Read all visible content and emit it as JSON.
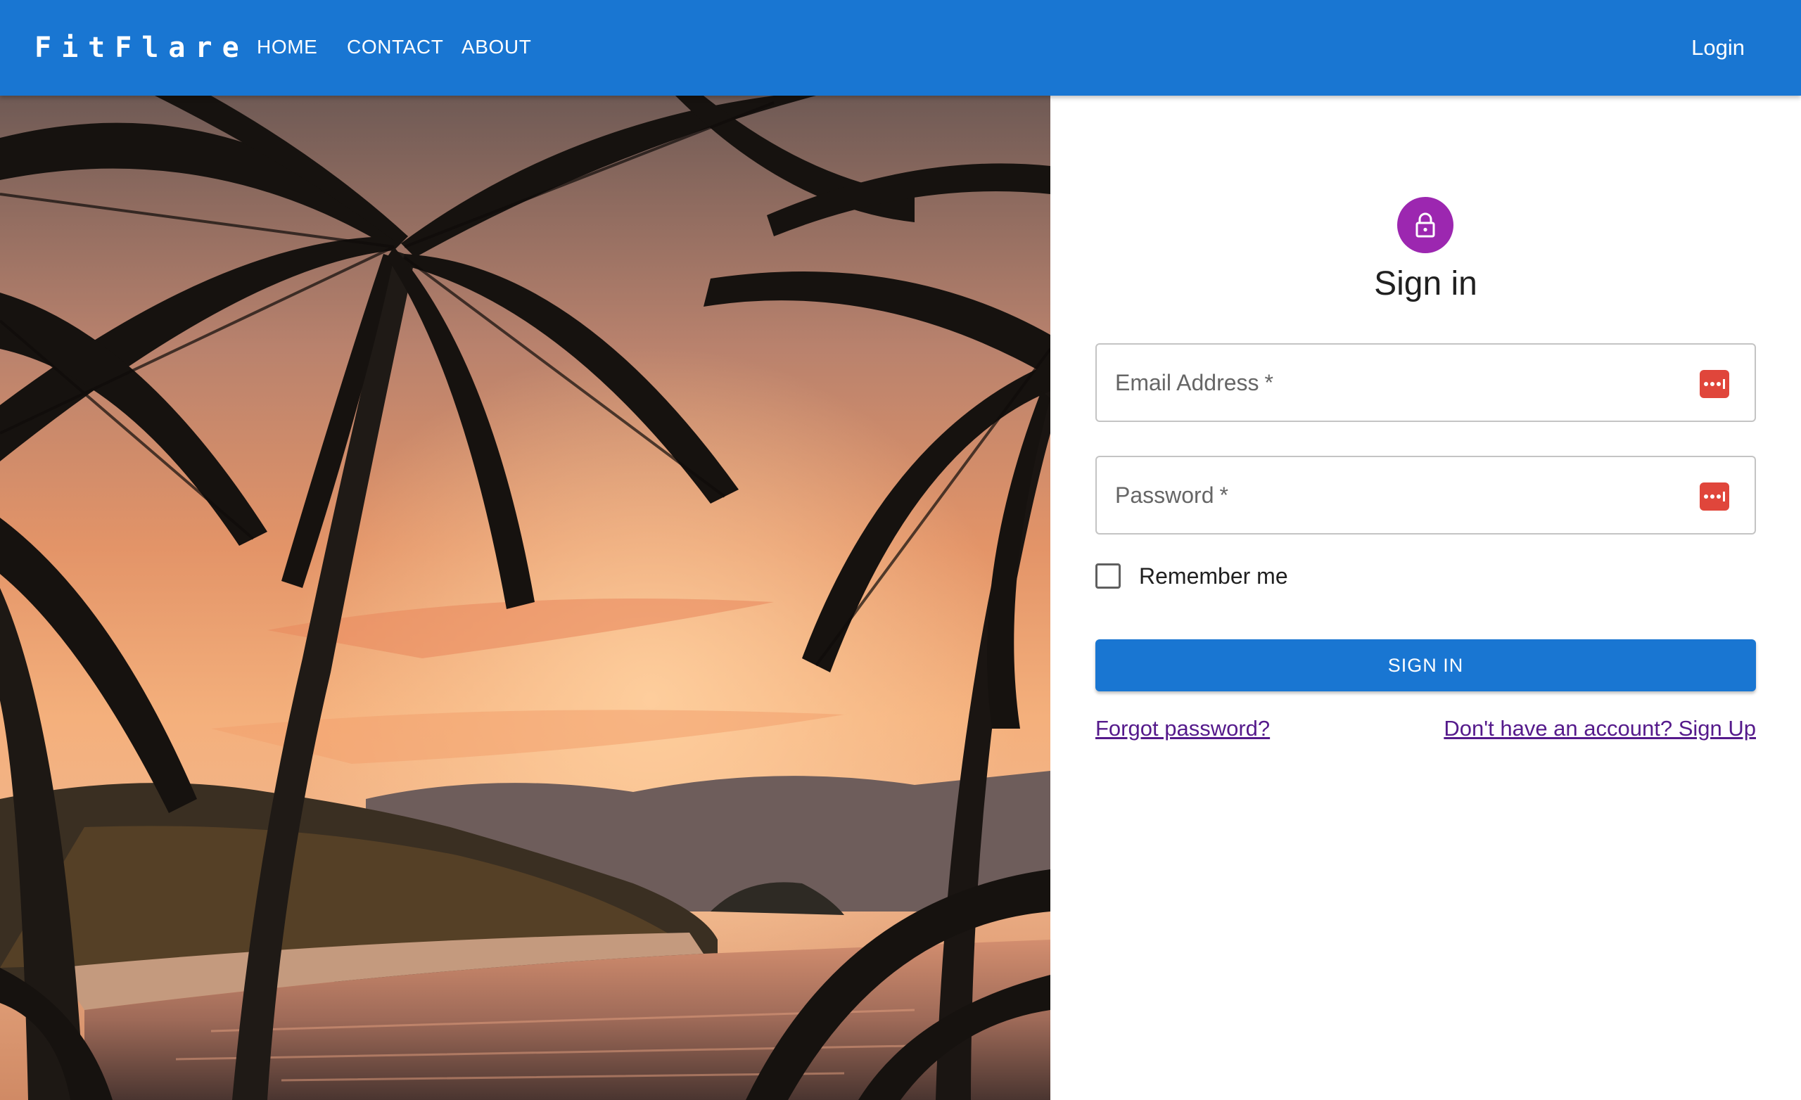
{
  "appbar": {
    "brand": "FitFlare",
    "nav": {
      "home": "HOME",
      "contact": "CONTACT",
      "about": "ABOUT"
    },
    "login": "Login",
    "color": "#1976d2"
  },
  "hero": {
    "image": "palm-tree-sunset-beach-photo"
  },
  "signin": {
    "icon": "lock-icon",
    "icon_color": "#9c27b0",
    "title": "Sign in",
    "email": {
      "label": "Email Address",
      "required_mark": "*",
      "value": ""
    },
    "password": {
      "label": "Password",
      "required_mark": "*",
      "value": ""
    },
    "password_manager_icon": "password-manager-icon",
    "remember": {
      "label": "Remember me",
      "checked": false
    },
    "submit_label": "SIGN IN",
    "forgot_link": "Forgot password?",
    "signup_link": "Don't have an account? Sign Up"
  }
}
